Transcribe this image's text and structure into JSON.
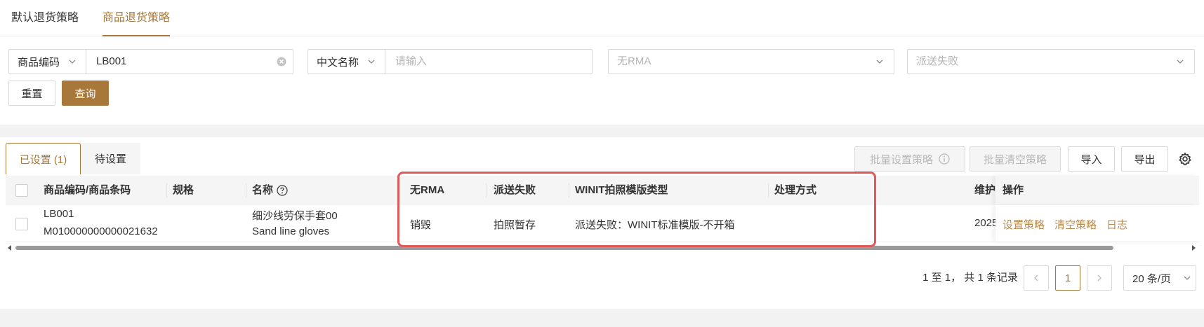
{
  "top_tabs": [
    {
      "label": "默认退货策略",
      "active": false
    },
    {
      "label": "商品退货策略",
      "active": true
    }
  ],
  "filters": {
    "code_type": "商品编码",
    "code_value": "LB001",
    "name_type": "中文名称",
    "name_placeholder": "请输入",
    "rma_placeholder": "无RMA",
    "dispatch_placeholder": "派送失败"
  },
  "actions": {
    "reset": "重置",
    "query": "查询"
  },
  "sub_tabs": [
    {
      "label": "已设置 (1)",
      "active": true
    },
    {
      "label": "待设置",
      "active": false
    }
  ],
  "toolbar": {
    "batch_set": "批量设置策略",
    "batch_clear": "批量清空策略",
    "import": "导入",
    "export": "导出"
  },
  "table": {
    "headers": {
      "code": "商品编码/商品条码",
      "spec": "规格",
      "name": "名称",
      "no_rma": "无RMA",
      "dispatch_fail": "派送失败",
      "photo_template": "WINIT拍照模版类型",
      "handling": "处理方式",
      "maintain": "维护",
      "ops": "操作"
    },
    "rows": [
      {
        "code": "LB001",
        "barcode": "M010000000000021632",
        "spec": "",
        "name_cn": "细沙线劳保手套00",
        "name_en": "Sand line gloves",
        "no_rma": "销毁",
        "dispatch_fail": "拍照暂存",
        "photo_template": "派送失败：WINIT标准模版-不开箱",
        "handling": "",
        "maintain": "2025",
        "op_set": "设置策略",
        "op_clear": "清空策略",
        "op_log": "日志"
      }
    ]
  },
  "pagination": {
    "summary": "1 至 1， 共 1 条记录",
    "current": "1",
    "page_size": "20 条/页"
  },
  "colors": {
    "accent": "#a8773a",
    "link": "#b88b52",
    "highlight": "#e05a5a"
  }
}
